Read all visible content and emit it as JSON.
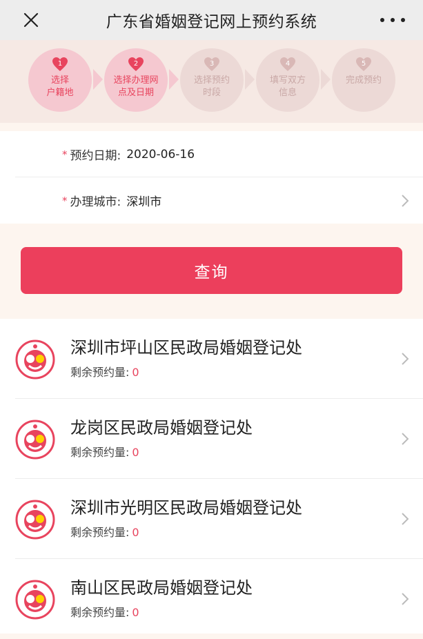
{
  "header": {
    "title": "广东省婚姻登记网上预约系统",
    "close_icon": "close-icon",
    "more_icon": "more-dots-icon"
  },
  "steps": [
    {
      "num": "1",
      "label": "选择\n户籍地",
      "state": "active"
    },
    {
      "num": "2",
      "label": "选择办理网\n点及日期",
      "state": "active"
    },
    {
      "num": "3",
      "label": "选择预约\n时段",
      "state": "inactive"
    },
    {
      "num": "4",
      "label": "填写双方\n信息",
      "state": "inactive"
    },
    {
      "num": "5",
      "label": "完成预约",
      "state": "inactive"
    }
  ],
  "form": {
    "date": {
      "label": "预约日期:",
      "value": "2020-06-16"
    },
    "city": {
      "label": "办理城市:",
      "value": "深圳市"
    }
  },
  "query_button": {
    "label": "查询"
  },
  "offices": [
    {
      "name": "深圳市坪山区民政局婚姻登记处",
      "remain_label": "剩余预约量:",
      "remain_value": "0"
    },
    {
      "name": "龙岗区民政局婚姻登记处",
      "remain_label": "剩余预约量:",
      "remain_value": "0"
    },
    {
      "name": "深圳市光明区民政局婚姻登记处",
      "remain_label": "剩余预约量:",
      "remain_value": "0"
    },
    {
      "name": "南山区民政局婚姻登记处",
      "remain_label": "剩余预约量:",
      "remain_value": "0"
    }
  ],
  "colors": {
    "accent": "#ec3f5c",
    "step_active_bg": "#f5c8d0",
    "step_inactive_bg": "#ecd9d6",
    "page_bg": "#fdf5ef"
  }
}
